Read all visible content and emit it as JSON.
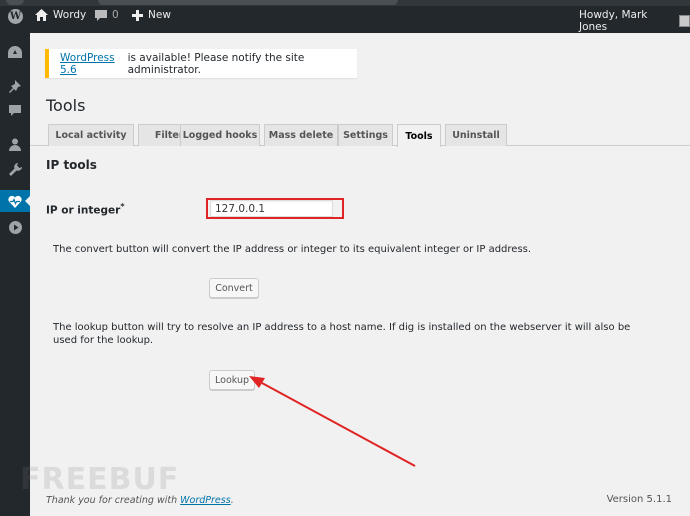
{
  "adminbar": {
    "site_name": "Wordy",
    "comments_count": "0",
    "new_label": "New",
    "greeting": "Howdy, Mark Jones"
  },
  "notice": {
    "link_text": "WordPress 5.6",
    "text": " is available! Please notify the site administrator."
  },
  "page_title": "Tools",
  "tabs": [
    {
      "label": "Local activity"
    },
    {
      "label": "Filters"
    },
    {
      "label": "Logged hooks"
    },
    {
      "label": "Mass delete"
    },
    {
      "label": "Settings"
    },
    {
      "label": "Tools",
      "active": true
    },
    {
      "label": "Uninstall"
    }
  ],
  "section_title": "IP tools",
  "ip_field": {
    "label": "IP or integer",
    "required_mark": "*",
    "value": "127.0.0.1"
  },
  "convert": {
    "description": "The convert button will convert the IP address or integer to its equivalent integer or IP address.",
    "button_label": "Convert"
  },
  "lookup": {
    "description": "The lookup button will try to resolve an IP address to a host name. If dig is installed on the webserver it will also be used for the lookup.",
    "button_label": "Lookup"
  },
  "footer": {
    "thanks_text": "Thank you for creating with ",
    "wordpress_link": "WordPress",
    "period": ".",
    "version": "Version 5.1.1"
  },
  "watermark_text": "FREEBUF",
  "colors": {
    "admin_bar": "#23282d",
    "accent": "#0073aa",
    "notice_warning": "#ffb900",
    "annotation_red": "#e02424"
  }
}
